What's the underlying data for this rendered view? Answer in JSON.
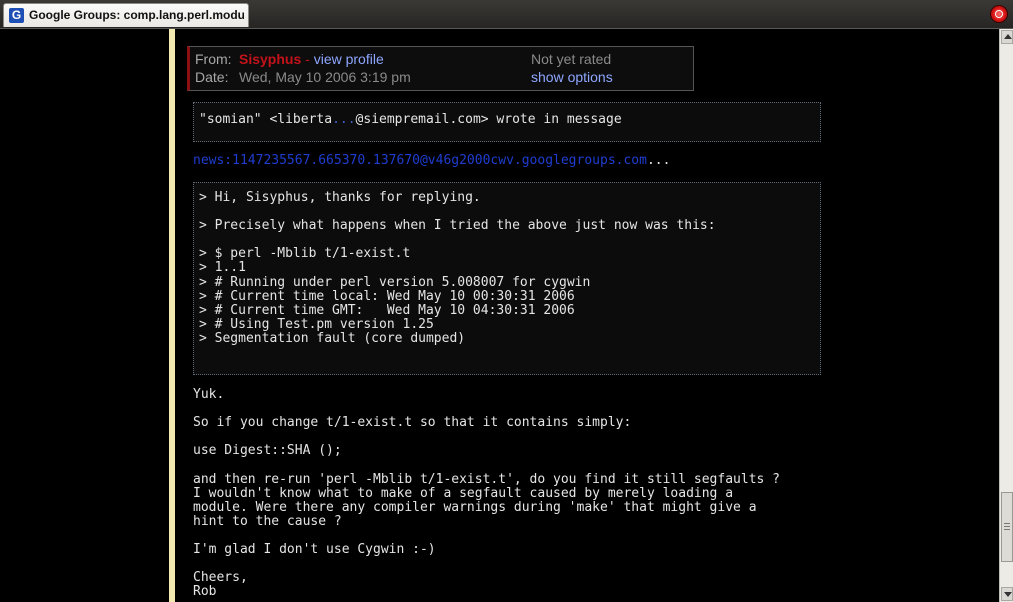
{
  "tab": {
    "icon": "google-g-icon",
    "title": "Google Groups: comp.lang.perl.modu..."
  },
  "header": {
    "from_label": "From:",
    "from_name": "Sisyphus",
    "separator": " - ",
    "view_profile": "view profile",
    "date_label": "Date:",
    "date_value": "Wed, May 10 2006 3:19 pm",
    "rating": "Not yet rated",
    "show_options": "show options"
  },
  "attribution": {
    "prefix": "\"somian\" <liberta",
    "hidden": "...",
    "suffix": "@siempremail.com> wrote in message"
  },
  "news_ref": {
    "link": "news:1147235567.665370.137670@v46g2000cwv.googlegroups.com",
    "trail": "..."
  },
  "quote_lines": [
    "> Hi, Sisyphus, thanks for replying.",
    "",
    "> Precisely what happens when I tried the above just now was this:",
    "",
    "> $ perl -Mblib t/1-exist.t",
    "> 1..1",
    "> # Running under perl version 5.008007 for cygwin",
    "> # Current time local: Wed May 10 00:30:31 2006",
    "> # Current time GMT:   Wed May 10 04:30:31 2006",
    "> # Using Test.pm version 1.25",
    "> Segmentation fault (core dumped)"
  ],
  "body_lines": [
    "Yuk.",
    "",
    "So if you change t/1-exist.t so that it contains simply:",
    "",
    "use Digest::SHA ();",
    "",
    "and then re-run 'perl -Mblib t/1-exist.t', do you find it still segfaults ?",
    "I wouldn't know what to make of a segfault caused by merely loading a",
    "module. Were there any compiler warnings during 'make' that might give a",
    "hint to the cause ?",
    "",
    "I'm glad I don't use Cygwin :-)",
    "",
    "Cheers,",
    "Rob"
  ],
  "colors": {
    "name_red": "#c3121a",
    "link_blue": "#8ea6ff",
    "news_blue": "#1f3dd1"
  }
}
